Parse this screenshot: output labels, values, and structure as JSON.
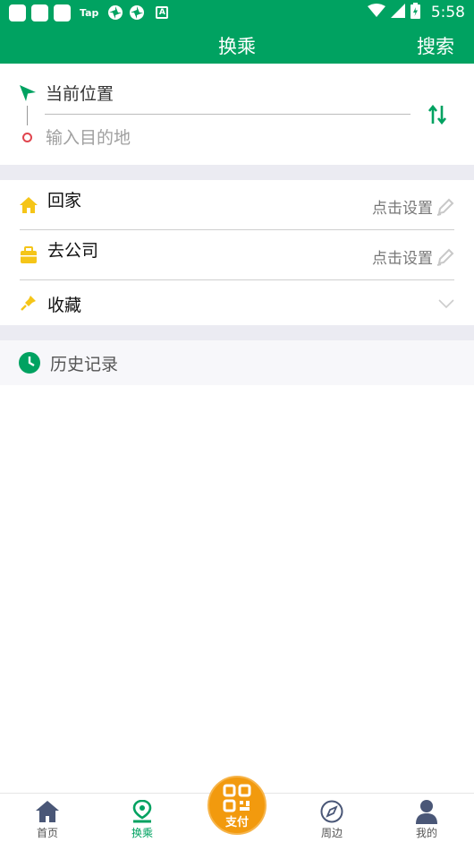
{
  "status_bar": {
    "tap_label": "Tap",
    "a_label": "A",
    "time": "5:58",
    "icons": [
      "app-icon",
      "app-icon",
      "app-icon",
      "tap-icon",
      "pinwheel-icon",
      "pinwheel-icon",
      "a-icon",
      "wifi-icon",
      "signal-icon",
      "battery-icon"
    ]
  },
  "header": {
    "title": "换乘",
    "search_label": "搜索"
  },
  "route": {
    "origin": "当前位置",
    "destination_placeholder": "输入目的地",
    "destination_value": ""
  },
  "shortcuts": [
    {
      "label": "回家",
      "action": "点击设置",
      "icon": "home-icon"
    },
    {
      "label": "去公司",
      "action": "点击设置",
      "icon": "briefcase-icon"
    },
    {
      "label": "收藏",
      "icon": "pin-icon"
    }
  ],
  "history": {
    "label": "历史记录",
    "icon": "clock-icon"
  },
  "bottom_nav": {
    "items": [
      {
        "label": "首页",
        "icon": "home-icon"
      },
      {
        "label": "换乘",
        "icon": "route-pin-icon",
        "active": true
      },
      {
        "label": "周边",
        "icon": "compass-icon"
      },
      {
        "label": "我的",
        "icon": "user-icon"
      }
    ],
    "pay_label": "支付"
  },
  "colors": {
    "primary": "#00a261",
    "home_icon": "#f5c518",
    "dest_dot": "#e0454e",
    "pay_button": "#f29a0e",
    "nav_icon": "#4a5777"
  }
}
